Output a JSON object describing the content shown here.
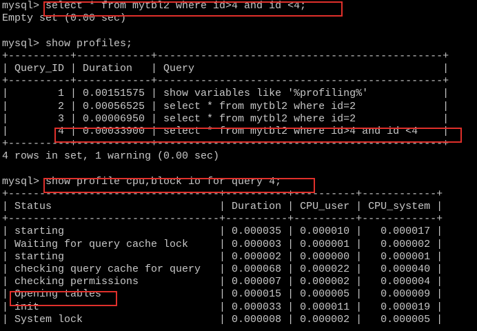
{
  "terminal": {
    "lines": [
      "mysql> select * from mytbl2 where id>4 and id <4;",
      "Empty set (0.00 sec)",
      "",
      "mysql> show profiles;",
      "+----------+------------+----------------------------------------------+",
      "| Query_ID | Duration   | Query                                        |",
      "+----------+------------+----------------------------------------------+",
      "|        1 | 0.00151575 | show variables like '%profiling%'            |",
      "|        2 | 0.00056525 | select * from mytbl2 where id=2              |",
      "|        3 | 0.00006950 | select * from mytbl2 where id=2              |",
      "|        4 | 0.00033900 | select * from mytbl2 where id>4 and id <4    |",
      "+----------+------------+----------------------------------------------+",
      "4 rows in set, 1 warning (0.00 sec)",
      "",
      "mysql> show profile cpu,block io for query 4;",
      "+----------------------------------+----------+----------+------------+",
      "| Status                           | Duration | CPU_user | CPU_system |",
      "+----------------------------------+----------+----------+------------+",
      "| starting                         | 0.000035 | 0.000010 |   0.000017 |",
      "| Waiting for query cache lock     | 0.000003 | 0.000001 |   0.000002 |",
      "| starting                         | 0.000002 | 0.000000 |   0.000001 |",
      "| checking query cache for query   | 0.000068 | 0.000022 |   0.000040 |",
      "| checking permissions             | 0.000007 | 0.000002 |   0.000004 |",
      "| Opening tables                   | 0.000015 | 0.000005 |   0.000009 |",
      "| init                             | 0.000033 | 0.000011 |   0.000019 |",
      "| System lock                      | 0.000008 | 0.000002 |   0.000005 |"
    ]
  },
  "colors": {
    "background": "#000000",
    "text": "#c8c8c8",
    "highlight": "#e0302b"
  }
}
